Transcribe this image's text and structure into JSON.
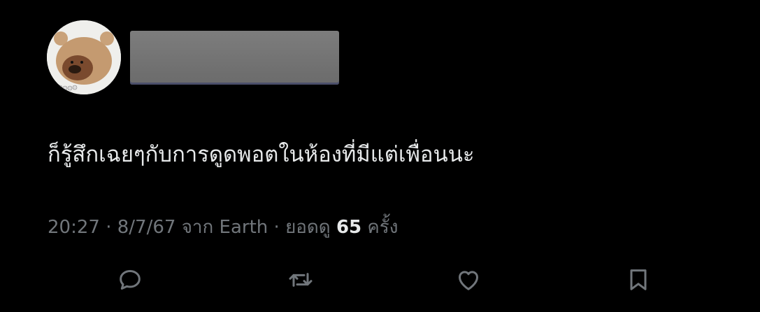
{
  "tweet": {
    "author_name_redacted": true,
    "text": "ก็รู้สึกเฉยๆกับการดูดพอตในห้องที่มีแต่เพื่อนนะ",
    "time": "20:27",
    "separator": " · ",
    "date": "8/7/67",
    "source_prefix": "จาก",
    "source": "Earth",
    "views_label_prefix": "ยอดดู",
    "views_count": "65",
    "views_label_suffix": "ครั้ง"
  },
  "actions": [
    {
      "icon": "reply-icon"
    },
    {
      "icon": "retweet-icon"
    },
    {
      "icon": "like-icon"
    },
    {
      "icon": "bookmark-icon"
    }
  ],
  "colors": {
    "background": "#000000",
    "primary_text": "#e7e9ea",
    "secondary_text": "#71767b",
    "icon": "#71767b"
  }
}
